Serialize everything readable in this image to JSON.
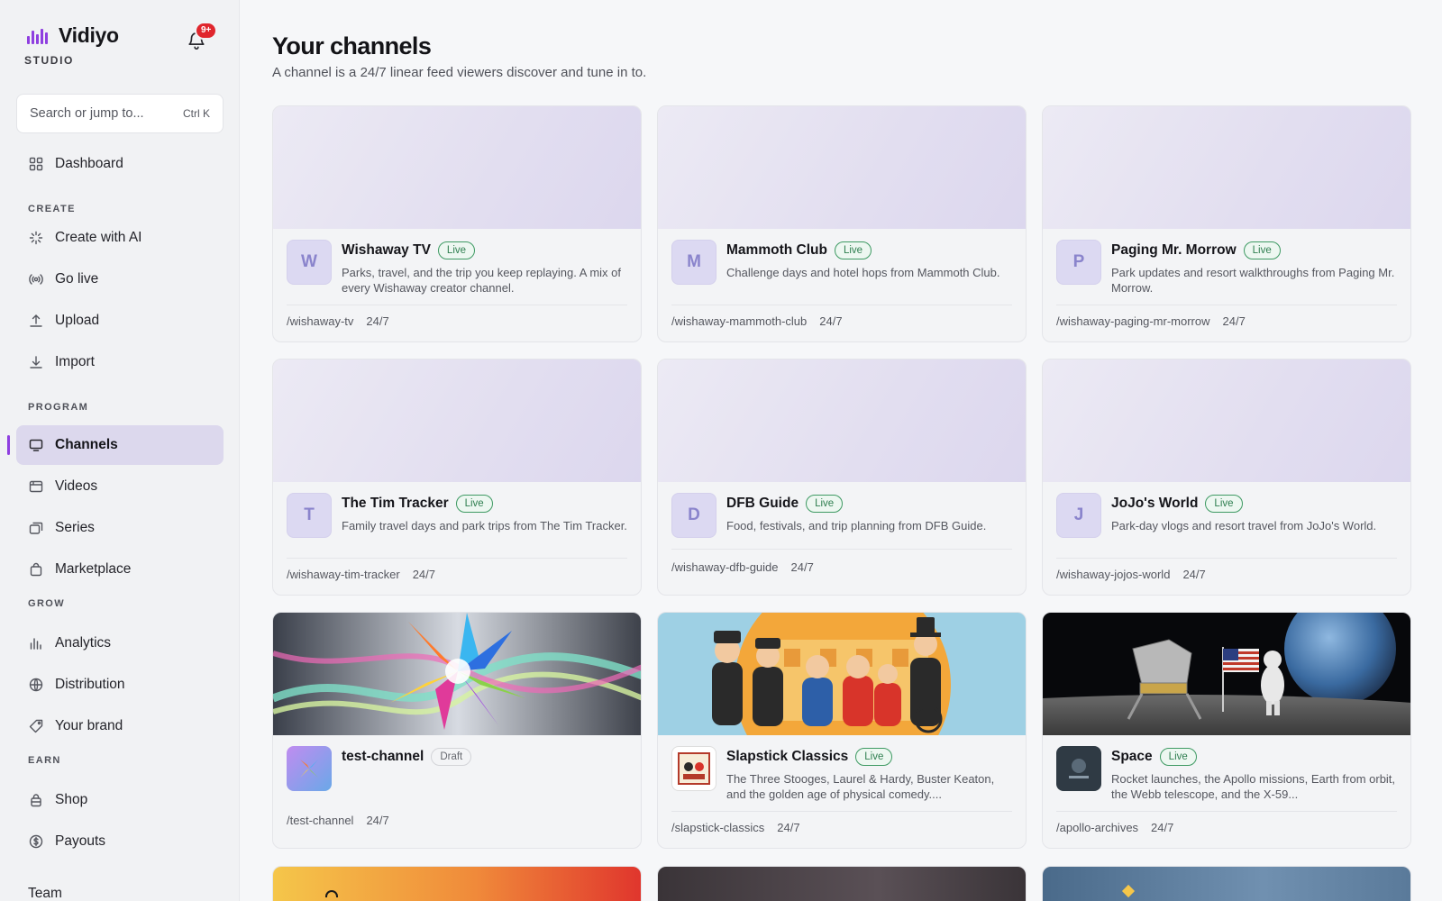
{
  "brand": {
    "name": "Vidiyo",
    "subtitle": "STUDIO",
    "notification_count": "9+"
  },
  "search": {
    "placeholder": "Search or jump to...",
    "shortcut": "Ctrl K"
  },
  "nav": {
    "dashboard": "Dashboard",
    "sections": {
      "create": "CREATE",
      "program": "PROGRAM",
      "grow": "GROW",
      "earn": "EARN"
    },
    "create_with_ai": "Create with AI",
    "go_live": "Go live",
    "upload": "Upload",
    "import": "Import",
    "channels": "Channels",
    "videos": "Videos",
    "series": "Series",
    "marketplace": "Marketplace",
    "analytics": "Analytics",
    "distribution": "Distribution",
    "your_brand": "Your brand",
    "shop": "Shop",
    "payouts": "Payouts",
    "team": "Team"
  },
  "header": {
    "title": "Your channels",
    "subtitle": "A channel is a 24/7 linear feed viewers discover and tune in to."
  },
  "channels": [
    {
      "initial": "W",
      "name": "Wishaway TV",
      "status": "Live",
      "description": "Parks, travel, and the trip you keep replaying. A mix of every Wishaway creator channel.",
      "slug": "/wishaway-tv",
      "schedule": "24/7"
    },
    {
      "initial": "M",
      "name": "Mammoth Club",
      "status": "Live",
      "description": "Challenge days and hotel hops from Mammoth Club.",
      "slug": "/wishaway-mammoth-club",
      "schedule": "24/7"
    },
    {
      "initial": "P",
      "name": "Paging Mr. Morrow",
      "status": "Live",
      "description": "Park updates and resort walkthroughs from Paging Mr. Morrow.",
      "slug": "/wishaway-paging-mr-morrow",
      "schedule": "24/7"
    },
    {
      "initial": "T",
      "name": "The Tim Tracker",
      "status": "Live",
      "description": "Family travel days and park trips from The Tim Tracker.",
      "slug": "/wishaway-tim-tracker",
      "schedule": "24/7"
    },
    {
      "initial": "D",
      "name": "DFB Guide",
      "status": "Live",
      "description": "Food, festivals, and trip planning from DFB Guide.",
      "slug": "/wishaway-dfb-guide",
      "schedule": "24/7"
    },
    {
      "initial": "J",
      "name": "JoJo's World",
      "status": "Live",
      "description": "Park-day vlogs and resort travel from JoJo's World.",
      "slug": "/wishaway-jojos-world",
      "schedule": "24/7"
    },
    {
      "name": "test-channel",
      "status": "Draft",
      "description": "",
      "slug": "/test-channel",
      "schedule": "24/7"
    },
    {
      "name": "Slapstick Classics",
      "status": "Live",
      "description": "The Three Stooges, Laurel & Hardy, Buster Keaton, and the golden age of physical comedy....",
      "slug": "/slapstick-classics",
      "schedule": "24/7"
    },
    {
      "name": "Space",
      "status": "Live",
      "description": "Rocket launches, the Apollo missions, Earth from orbit, the Webb telescope, and the X-59...",
      "slug": "/apollo-archives",
      "schedule": "24/7"
    }
  ],
  "colors": {
    "accent": "#8f3fe0",
    "live": "#2f7f50",
    "badge": "#e0262d"
  }
}
